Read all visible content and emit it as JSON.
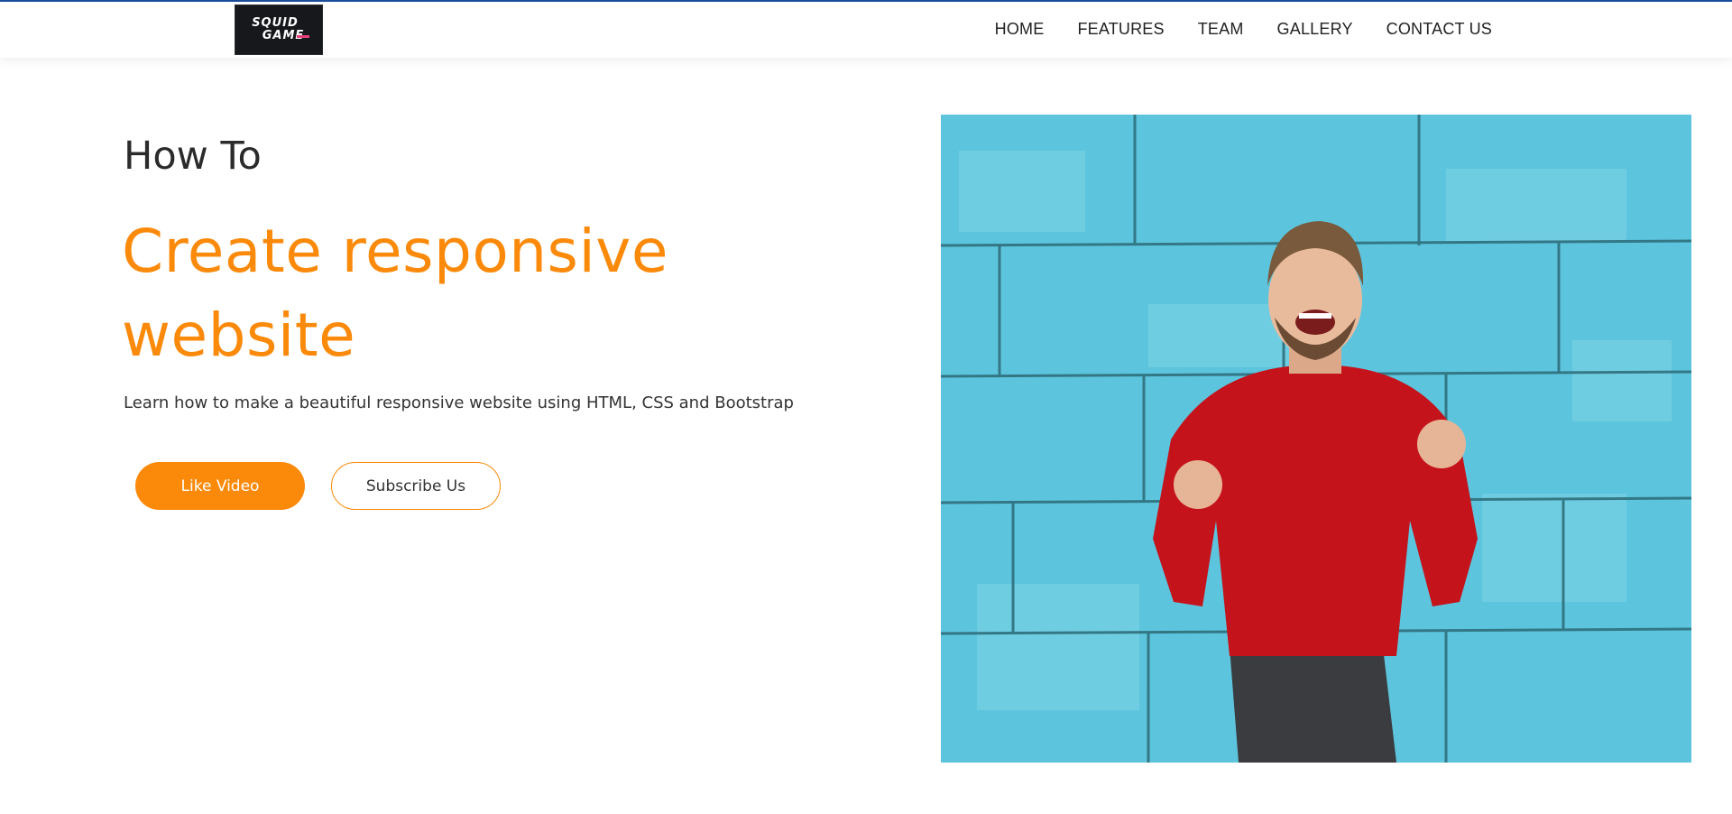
{
  "brand": {
    "logo_text_line1": "SQUID",
    "logo_text_line2": "GAME",
    "accent_color": "#fb8a0b",
    "topline_color": "#1c4f9c"
  },
  "nav": {
    "items": [
      {
        "label": "HOME"
      },
      {
        "label": "FEATURES"
      },
      {
        "label": "TEAM"
      },
      {
        "label": "GALLERY"
      },
      {
        "label": "CONTACT US"
      }
    ]
  },
  "hero": {
    "kicker": "How To",
    "headline_line1": "Create responsive",
    "headline_line2": "website",
    "subtitle": "Learn how to make a beautiful responsive website using HTML, CSS and Bootstrap",
    "primary_button": "Like Video",
    "secondary_button": "Subscribe Us"
  },
  "image": {
    "subject": "man in red sweater cheering in front of blue brick wall"
  }
}
